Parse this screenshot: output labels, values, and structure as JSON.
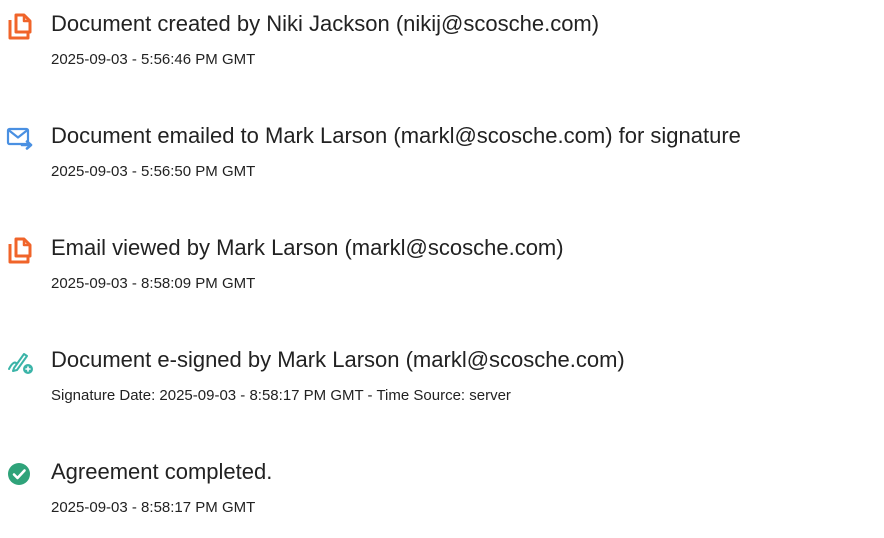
{
  "events": [
    {
      "icon": "document-icon",
      "title": "Document created by Niki Jackson (nikij@scosche.com)",
      "detail": "2025-09-03 - 5:56:46 PM GMT"
    },
    {
      "icon": "email-send-icon",
      "title": "Document emailed to Mark Larson (markl@scosche.com) for signature",
      "detail": "2025-09-03 - 5:56:50 PM GMT"
    },
    {
      "icon": "document-icon",
      "title": "Email viewed by Mark Larson (markl@scosche.com)",
      "detail": "2025-09-03 - 8:58:09 PM GMT"
    },
    {
      "icon": "pen-signature-icon",
      "title": "Document e-signed by Mark Larson (markl@scosche.com)",
      "detail": "Signature Date: 2025-09-03 - 8:58:17 PM GMT - Time Source: server"
    },
    {
      "icon": "check-circle-icon",
      "title": "Agreement completed.",
      "detail": "2025-09-03 - 8:58:17 PM GMT"
    }
  ],
  "colors": {
    "document_icon": "#f0642a",
    "email_icon": "#4a90e2",
    "signature_icon": "#3bb4a8",
    "check_icon": "#2fa37a"
  }
}
